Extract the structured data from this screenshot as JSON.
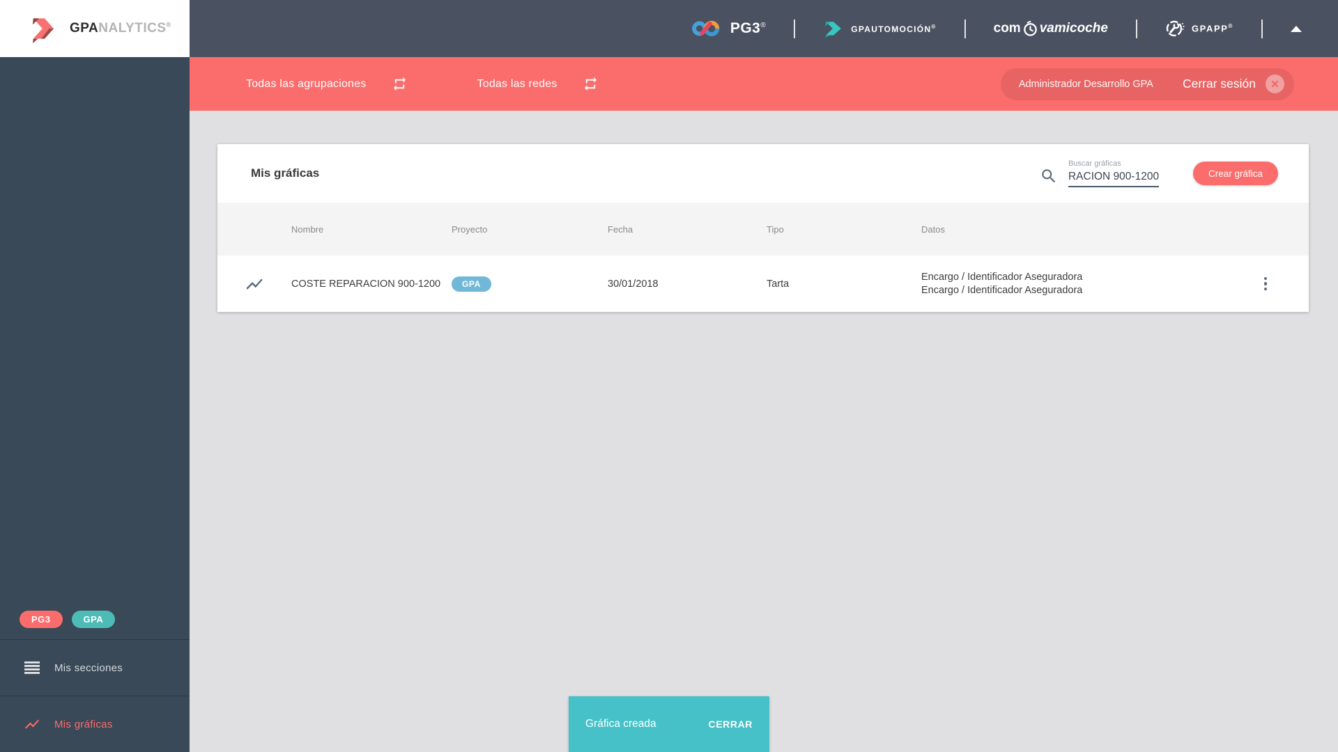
{
  "brand": {
    "bold": "GPA",
    "light": "NALYTICS",
    "reg": "®"
  },
  "topbar": {
    "pg3": {
      "label": "PG3",
      "reg": "®"
    },
    "automocion": {
      "label": "GPAUTOMOCIÓN",
      "reg": "®"
    },
    "comvamicoche": {
      "pre": "com",
      "post": "vamicoche"
    },
    "gpaapp": {
      "label": "GPAPP",
      "reg": "®"
    }
  },
  "filterbar": {
    "agrupaciones_label": "Todas las agrupaciones",
    "redes_label": "Todas las redes",
    "user_label": "Administrador Desarrollo GPA",
    "logout_label": "Cerrar sesión",
    "logout_close": "✕"
  },
  "sidebar": {
    "badges": [
      {
        "label": "PG3"
      },
      {
        "label": "GPA"
      }
    ],
    "items": [
      {
        "label": "Mis secciones"
      },
      {
        "label": "Mis gráficas"
      }
    ]
  },
  "content": {
    "title": "Mis gráficas",
    "search": {
      "label": "Buscar gráficas",
      "value": "RACION 900-1200"
    },
    "create_button": "Crear gráfica",
    "table": {
      "columns": [
        "Nombre",
        "Proyecto",
        "Fecha",
        "Tipo",
        "Datos"
      ],
      "rows": [
        {
          "nombre": "COSTE REPARACION 900-1200",
          "proyecto_badge": "GPA",
          "fecha": "30/01/2018",
          "tipo": "Tarta",
          "datos": [
            "Encargo / Identificador Aseguradora",
            "Encargo / Identificador Aseguradora"
          ]
        }
      ]
    }
  },
  "snackbar": {
    "message": "Gráfica creada",
    "action": "CERRAR"
  },
  "colors": {
    "accent_salmon": "#fb6c6c",
    "snackbar_teal": "#46c1c7",
    "badge_teal": "#4dbcb6",
    "badge_blue": "#71b8d8",
    "header_dark": "#4a5261",
    "sidebar_dark": "#394957",
    "page_bg": "#e0e0e2"
  }
}
